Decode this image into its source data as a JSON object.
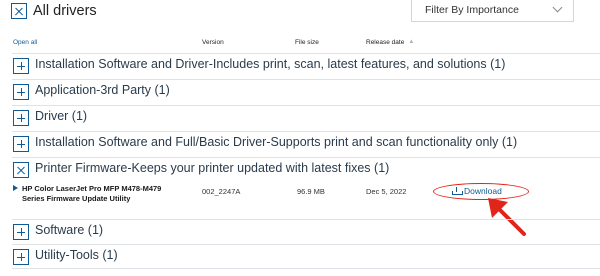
{
  "header": {
    "all_drivers_label": "All drivers",
    "filter_label": "Filter By Importance"
  },
  "columns": {
    "open_all": "Open all",
    "version": "Version",
    "file_size": "File size",
    "release_date": "Release date"
  },
  "categories": [
    {
      "label": "Installation Software and Driver-Includes print, scan, latest features, and solutions (1)",
      "expanded": false
    },
    {
      "label": "Application-3rd Party (1)",
      "expanded": false
    },
    {
      "label": "Driver (1)",
      "expanded": false
    },
    {
      "label": "Installation Software and Full/Basic Driver-Supports print and scan functionality only (1)",
      "expanded": false
    },
    {
      "label": "Printer Firmware-Keeps your printer updated with latest fixes (1)",
      "expanded": true
    },
    {
      "label": "Software (1)",
      "expanded": false
    },
    {
      "label": "Utility-Tools (1)",
      "expanded": false
    }
  ],
  "firmware_item": {
    "name": "HP Color LaserJet Pro MFP M478-M479 Series Firmware Update Utility",
    "version": "002_2247A",
    "file_size": "96.9 MB",
    "release_date": "Dec 5, 2022",
    "download_label": "Download"
  },
  "colors": {
    "accent": "#0f5a97",
    "highlight": "#e1251b"
  }
}
